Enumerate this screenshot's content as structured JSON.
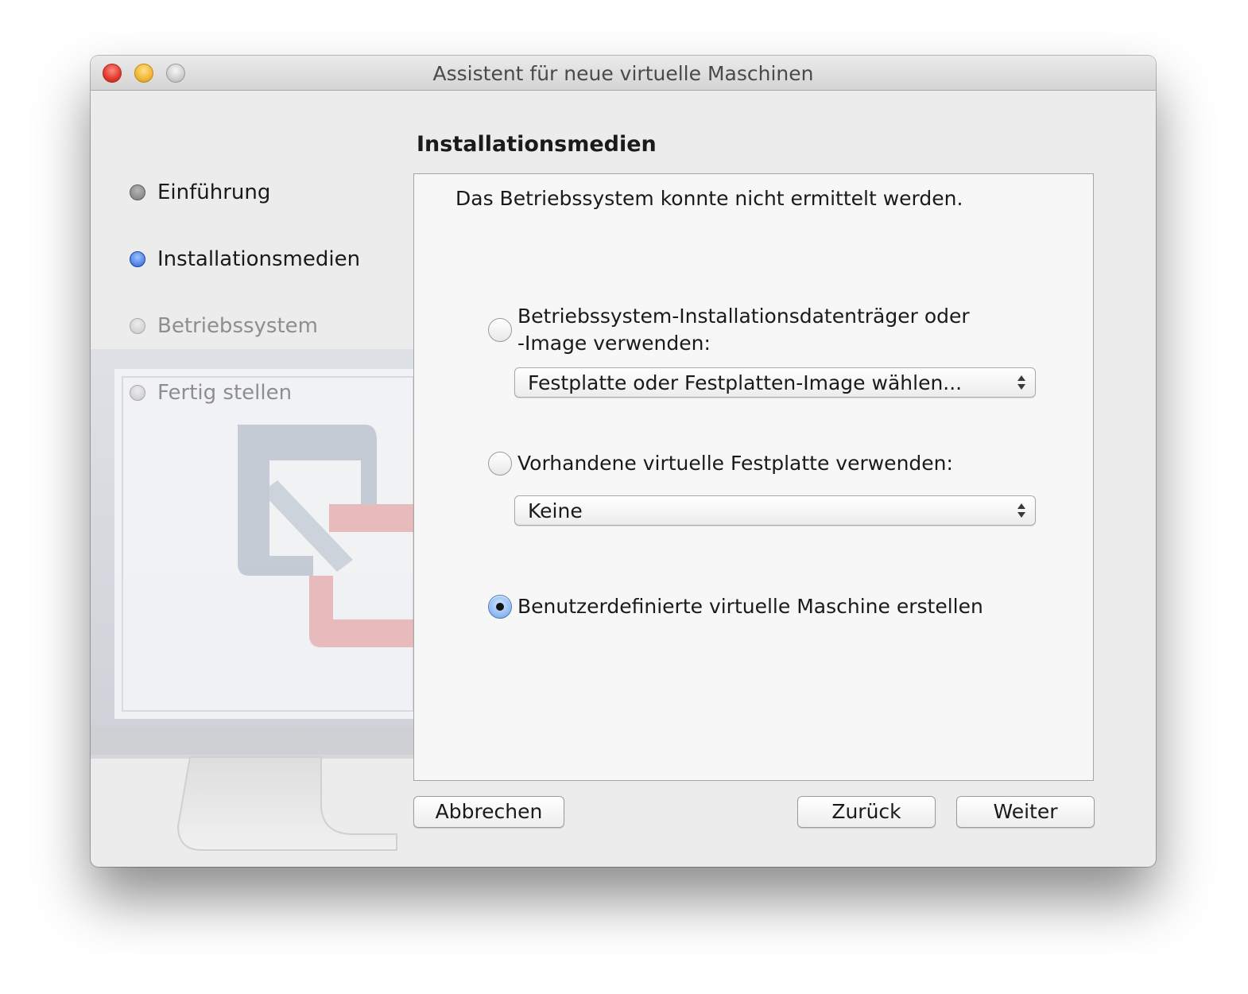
{
  "window": {
    "title": "Assistent für neue virtuelle Maschinen"
  },
  "steps": [
    {
      "label": "Einführung",
      "state": "done"
    },
    {
      "label": "Installationsmedien",
      "state": "current"
    },
    {
      "label": "Betriebssystem",
      "state": "future"
    },
    {
      "label": "Fertig stellen",
      "state": "future"
    }
  ],
  "main": {
    "section_title": "Installationsmedien",
    "status_message": "Das Betriebssystem konnte nicht ermittelt werden.",
    "option_install_disc": {
      "label_line1": "Betriebssystem-Installationsdatenträger oder",
      "label_line2": "-Image verwenden:",
      "selected": false,
      "popup_value": "Festplatte oder Festplatten-Image wählen..."
    },
    "option_existing_disk": {
      "label": "Vorhandene virtuelle Festplatte verwenden:",
      "selected": false,
      "popup_value": "Keine"
    },
    "option_custom_vm": {
      "label": "Benutzerdefinierte virtuelle Maschine erstellen",
      "selected": true
    }
  },
  "buttons": {
    "cancel": "Abbrechen",
    "back": "Zurück",
    "next": "Weiter"
  },
  "colors": {
    "current_step": "#2c63d6",
    "window_bg": "#ececec"
  }
}
